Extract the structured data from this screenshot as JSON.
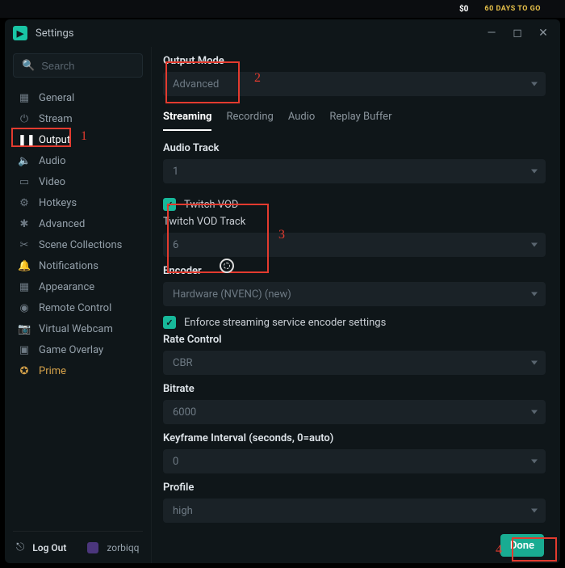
{
  "topbar": {
    "money": "$0",
    "days": "60 DAYS TO GO"
  },
  "window": {
    "title": "Settings"
  },
  "search": {
    "placeholder": "Search"
  },
  "sidebar": {
    "items": [
      {
        "label": "General",
        "icon": "▦"
      },
      {
        "label": "Stream",
        "icon": "⏻"
      },
      {
        "label": "Output",
        "icon": "❚❚"
      },
      {
        "label": "Audio",
        "icon": "🔈"
      },
      {
        "label": "Video",
        "icon": "▭"
      },
      {
        "label": "Hotkeys",
        "icon": "⚙"
      },
      {
        "label": "Advanced",
        "icon": "✱"
      },
      {
        "label": "Scene Collections",
        "icon": "✂"
      },
      {
        "label": "Notifications",
        "icon": "🔔"
      },
      {
        "label": "Appearance",
        "icon": "▦"
      },
      {
        "label": "Remote Control",
        "icon": "◉"
      },
      {
        "label": "Virtual Webcam",
        "icon": "📷"
      },
      {
        "label": "Game Overlay",
        "icon": "▣"
      },
      {
        "label": "Prime",
        "icon": "✪"
      }
    ]
  },
  "footer": {
    "logout": "Log Out",
    "username": "zorbiqq"
  },
  "form": {
    "output_mode_label": "Output Mode",
    "output_mode_value": "Advanced",
    "tabs": [
      "Streaming",
      "Recording",
      "Audio",
      "Replay Buffer"
    ],
    "audio_track_label": "Audio Track",
    "audio_track_value": "1",
    "twitch_vod_checkbox": "Twitch VOD",
    "twitch_vod_track_label": "Twitch VOD Track",
    "twitch_vod_track_value": "6",
    "encoder_label": "Encoder",
    "encoder_value": "Hardware (NVENC) (new)",
    "enforce_label": "Enforce streaming service encoder settings",
    "rate_control_label": "Rate Control",
    "rate_control_value": "CBR",
    "bitrate_label": "Bitrate",
    "bitrate_value": "6000",
    "keyframe_label": "Keyframe Interval (seconds, 0=auto)",
    "keyframe_value": "0",
    "profile_label": "Profile",
    "profile_value": "high"
  },
  "done": "Done",
  "annotations": {
    "n1": "1",
    "n2": "2",
    "n3": "3",
    "n4": "4"
  }
}
